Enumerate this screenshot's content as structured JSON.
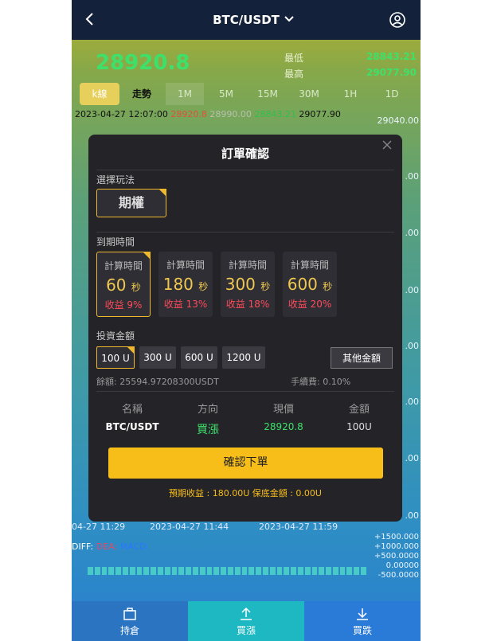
{
  "header": {
    "pair": "BTC/USDT"
  },
  "ticker": {
    "price": "28920.8",
    "low_label": "最低",
    "low_value": "28843.21",
    "high_label": "最高",
    "high_value": "29077.90"
  },
  "tabs": [
    "k線",
    "走勢",
    "1M",
    "5M",
    "15M",
    "30M",
    "1H",
    "1D"
  ],
  "ohlc_line": {
    "datetime": "2023-04-27 12:07:00",
    "open": "28920.8",
    "close": "28990.00",
    "low": "28843.21",
    "high": "29077.90"
  },
  "chart_axis": {
    "price_ticks": [
      "29040.00",
      ".00",
      ".00",
      ".00",
      ".00",
      ".00",
      ".00",
      ".00",
      ".00"
    ],
    "time_ticks": [
      "04-27 11:29",
      "2023-04-27 11:44",
      "2023-04-27 11:59"
    ],
    "diff_label": "DIFF:",
    "diff_sub": [
      "DEA:",
      "MACD:"
    ],
    "macd_ticks": [
      "+1500.000",
      "+1000.000",
      "+500.0000",
      "0.00000",
      "-500.0000"
    ]
  },
  "modal": {
    "title": "訂單確認",
    "play_label": "選擇玩法",
    "play_option": "期權",
    "expiry_label": "到期時間",
    "expiry_options": [
      {
        "title": "計算時間",
        "seconds": "60",
        "unit": "秒",
        "yield": "收益 9%"
      },
      {
        "title": "計算時間",
        "seconds": "180",
        "unit": "秒",
        "yield": "收益 13%"
      },
      {
        "title": "計算時間",
        "seconds": "300",
        "unit": "秒",
        "yield": "收益 18%"
      },
      {
        "title": "計算時間",
        "seconds": "600",
        "unit": "秒",
        "yield": "收益 20%"
      }
    ],
    "amount_label": "投資金額",
    "amounts": [
      "100 U",
      "300 U",
      "600 U",
      "1200 U"
    ],
    "other_amount": "其他金額",
    "balance": "餘額: 25594.97208300USDT",
    "fee": "手續費: 0.10%",
    "columns": [
      "名稱",
      "方向",
      "現價",
      "金額"
    ],
    "row": {
      "name": "BTC/USDT",
      "direction": "買漲",
      "price": "28920.8",
      "amount": "100U"
    },
    "confirm": "確認下單",
    "expected": "預期收益 : 180.00U    保底金額 : 0.00U"
  },
  "bottom_nav": [
    "持倉",
    "買漲",
    "買跌"
  ],
  "colors": {
    "accent": "#f7bd19",
    "up": "#3ee06a",
    "down": "#ff4a5a",
    "header": "#14213a"
  }
}
